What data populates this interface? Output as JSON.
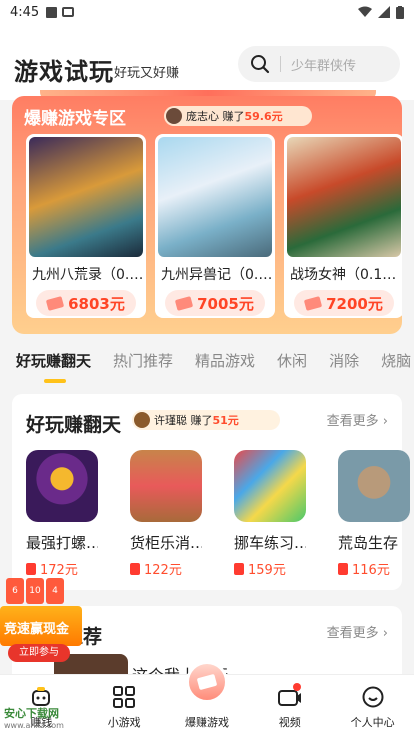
{
  "status_bar": {
    "time": "4:45"
  },
  "header": {
    "title": "游戏试玩",
    "subtitle": "好玩又好赚"
  },
  "search": {
    "placeholder": "少年群侠传"
  },
  "earn_zone": {
    "title": "爆赚游戏专区",
    "ticker": {
      "user": "庞志心",
      "verb": "赚了",
      "amount": "59.6元"
    },
    "cards": [
      {
        "name": "九州八荒录（0.…",
        "reward": "6803元"
      },
      {
        "name": "九州异兽记（0.…",
        "reward": "7005元"
      },
      {
        "name": "战场女神（0.1…",
        "reward": "7200元"
      }
    ]
  },
  "tabs": [
    "好玩赚翻天",
    "热门推荐",
    "精品游戏",
    "休闲",
    "消除",
    "烧脑"
  ],
  "section1": {
    "title": "好玩赚翻天",
    "ticker": {
      "user": "许瑾聪",
      "verb": "赚了",
      "amount": "51元"
    },
    "more": "查看更多",
    "games": [
      {
        "name": "最强打螺…",
        "reward": "172元"
      },
      {
        "name": "货柜乐消…",
        "reward": "122元"
      },
      {
        "name": "挪车练习…",
        "reward": "159元"
      },
      {
        "name": "荒岛生存",
        "reward": "116元"
      }
    ]
  },
  "section2": {
    "title": "精品推荐",
    "more": "查看更多",
    "preview_text": "这个我上一行"
  },
  "floating_promo": {
    "title": "竞速赢现金",
    "join": "立即参与",
    "chips": [
      "6",
      "10",
      "4"
    ]
  },
  "bottom_nav": [
    {
      "label": "赚钱"
    },
    {
      "label": "小游戏"
    },
    {
      "label": "爆赚游戏"
    },
    {
      "label": "视频"
    },
    {
      "label": "个人中心"
    }
  ],
  "watermark": {
    "brand": "安心下载网",
    "url": "www.anxz.com"
  }
}
